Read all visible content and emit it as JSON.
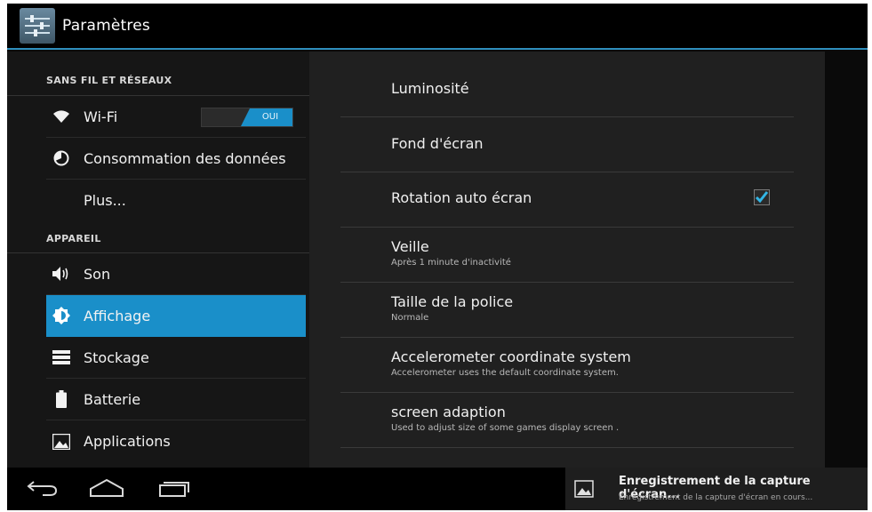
{
  "colors": {
    "accent": "#1a8fc9",
    "actionbar_line": "#2f8fbd"
  },
  "actionbar": {
    "title": "Paramètres",
    "icon": "settings-sliders-icon"
  },
  "sidebar": {
    "sections": [
      {
        "header": "SANS FIL ET RÉSEAUX",
        "items": [
          {
            "label": "Wi-Fi",
            "icon": "wifi-icon",
            "toggle": "OUI"
          },
          {
            "label": "Consommation des données",
            "icon": "data-usage-icon"
          },
          {
            "label": "Plus..."
          }
        ]
      },
      {
        "header": "APPAREIL",
        "items": [
          {
            "label": "Son",
            "icon": "speaker-icon"
          },
          {
            "label": "Affichage",
            "icon": "brightness-icon",
            "selected": true
          },
          {
            "label": "Stockage",
            "icon": "storage-icon"
          },
          {
            "label": "Batterie",
            "icon": "battery-icon"
          },
          {
            "label": "Applications",
            "icon": "apps-icon"
          }
        ]
      }
    ]
  },
  "display": {
    "items": [
      {
        "title": "Luminosité"
      },
      {
        "title": "Fond d'écran"
      },
      {
        "title": "Rotation auto écran",
        "checked": true
      },
      {
        "title": "Veille",
        "summary": "Après 1 minute d'inactivité"
      },
      {
        "title": "Taille de la police",
        "summary": "Normale"
      },
      {
        "title": "Accelerometer coordinate system",
        "summary": "Accelerometer uses the default coordinate system."
      },
      {
        "title": "screen adaption",
        "summary": "Used to adjust size of some games display screen ."
      }
    ]
  },
  "navbar": {
    "buttons": [
      "back-icon",
      "home-icon",
      "recent-apps-icon"
    ]
  },
  "notification": {
    "icon": "image-icon",
    "title": "Enregistrement de la capture d'écran...",
    "text": "Enregistrement de la capture d'écran en cours..."
  }
}
